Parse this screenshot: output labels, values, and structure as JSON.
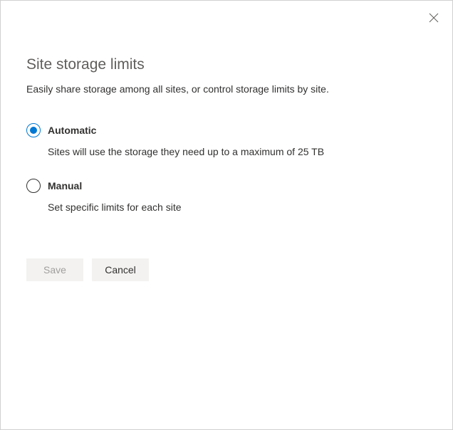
{
  "header": {
    "title": "Site storage limits",
    "subtitle": "Easily share storage among all sites, or control storage limits by site."
  },
  "options": {
    "automatic": {
      "label": "Automatic",
      "description": "Sites will use the storage they need up to a maximum of 25 TB",
      "selected": true
    },
    "manual": {
      "label": "Manual",
      "description": "Set specific limits for each site",
      "selected": false
    }
  },
  "buttons": {
    "save_label": "Save",
    "cancel_label": "Cancel"
  }
}
